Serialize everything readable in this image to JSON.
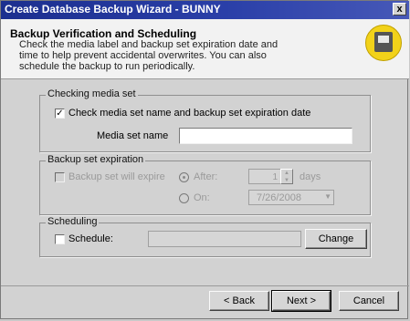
{
  "window": {
    "title": "Create Database Backup Wizard - BUNNY",
    "close_glyph": "x"
  },
  "header": {
    "title": "Backup Verification and Scheduling",
    "description": "Check the media label and backup set expiration date and time to help prevent accidental overwrites. You can also schedule the backup to run periodically."
  },
  "checking_media": {
    "group_label": "Checking media set",
    "check_label": "Check media set name and backup set expiration date",
    "checked": true,
    "media_name_label": "Media set name",
    "media_name_value": ""
  },
  "expiration": {
    "group_label": "Backup set expiration",
    "check_label": "Backup set will expire",
    "after_label": "After:",
    "after_value": "1",
    "days_label": "days",
    "on_label": "On:",
    "on_value": "7/26/2008"
  },
  "scheduling": {
    "group_label": "Scheduling",
    "schedule_label": "Schedule:",
    "schedule_value": "",
    "change_label": "Change"
  },
  "footer": {
    "back_label": "< Back",
    "next_label": "Next >",
    "cancel_label": "Cancel"
  }
}
